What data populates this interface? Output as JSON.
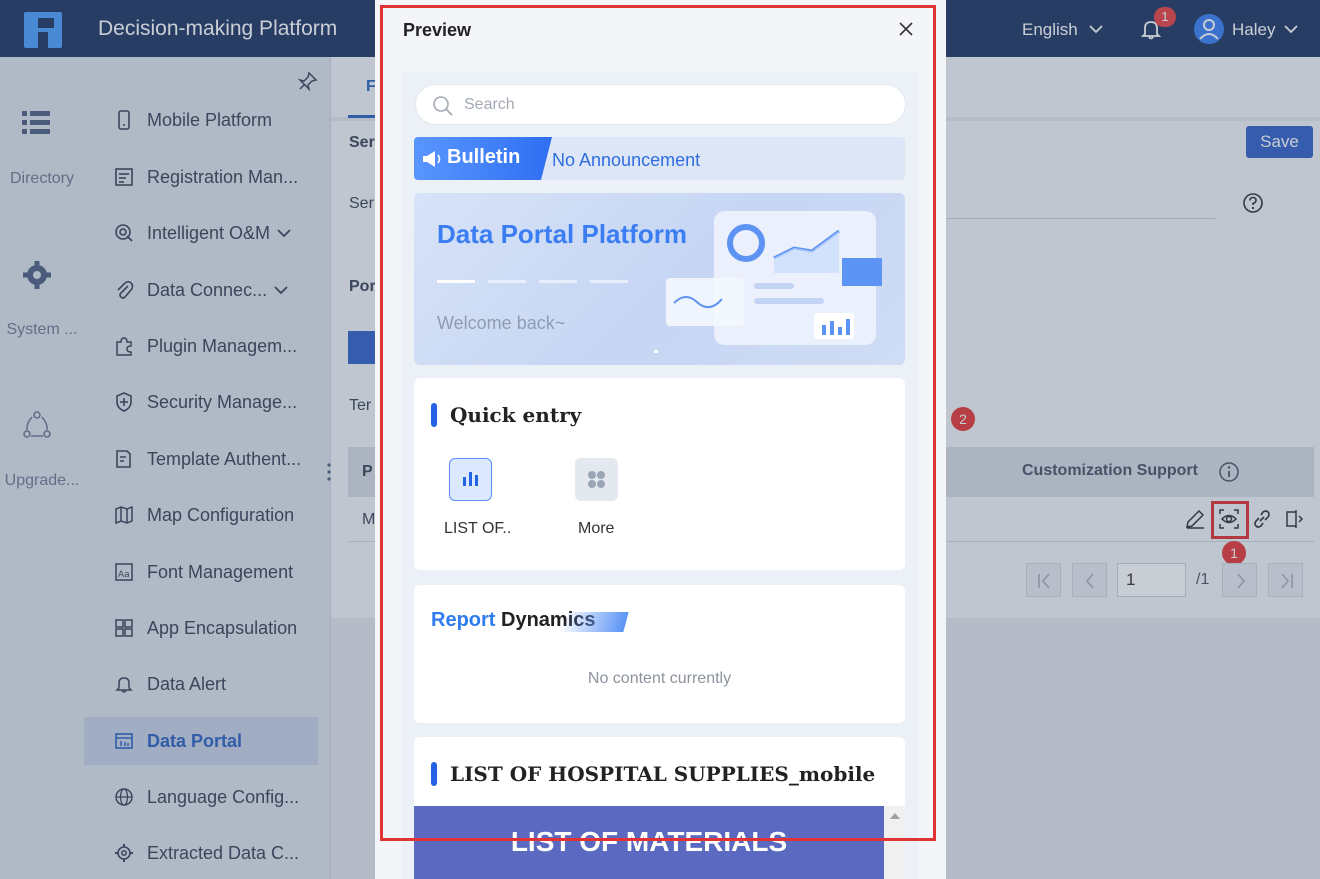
{
  "header": {
    "app_title": "Decision-making Platform",
    "language": "English",
    "notification_count": "1",
    "user_name": "Haley"
  },
  "rail": {
    "items": [
      {
        "label": "Directory",
        "icon": "list-icon"
      },
      {
        "label": "System ...",
        "icon": "gear-icon"
      },
      {
        "label": "Upgrade...",
        "icon": "upgrade-icon"
      }
    ]
  },
  "sidebar": {
    "items": [
      {
        "label": "Mobile Platform",
        "icon": "mobile-icon"
      },
      {
        "label": "Registration Man...",
        "icon": "registration-icon"
      },
      {
        "label": "Intelligent O&M",
        "icon": "om-icon"
      },
      {
        "label": "Data Connec...",
        "icon": "paperclip-icon"
      },
      {
        "label": "Plugin Managem...",
        "icon": "puzzle-icon"
      },
      {
        "label": "Security Manage...",
        "icon": "shield-icon"
      },
      {
        "label": "Template Authent...",
        "icon": "template-auth-icon"
      },
      {
        "label": "Map Configuration",
        "icon": "map-icon"
      },
      {
        "label": "Font Management",
        "icon": "font-icon"
      },
      {
        "label": "App Encapsulation",
        "icon": "app-grid-icon"
      },
      {
        "label": "Data Alert",
        "icon": "bell-icon"
      },
      {
        "label": "Data Portal",
        "icon": "portal-icon"
      },
      {
        "label": "Language Config...",
        "icon": "globe-icon"
      },
      {
        "label": "Extracted Data C...",
        "icon": "gear-icon"
      }
    ]
  },
  "background": {
    "tab_fragment": "F",
    "section_fragment_1": "Ser",
    "section_fragment_2": "Ser",
    "section_fragment_3": "Por",
    "terminal_fragment": "Ter",
    "table_head_fragment": "P",
    "row_fragment": "M",
    "save_label": "Save",
    "customization_label": "Customization Support",
    "page_input": "1",
    "page_total": "/1",
    "marker_1": "1",
    "marker_2": "2"
  },
  "modal": {
    "title": "Preview",
    "search_placeholder": "Search",
    "bulletin_label": "Bulletin",
    "bulletin_text": "No Announcement",
    "banner_title": "Data Portal Platform",
    "banner_subtitle": "Welcome back~",
    "quick_entry": {
      "title": "Quick entry",
      "items": [
        {
          "label": "LIST OF..",
          "icon": "bar-chart-icon"
        },
        {
          "label": "More",
          "icon": "more-grid-icon"
        }
      ]
    },
    "report": {
      "title_part_1": "Report",
      "title_part_2": "Dynamics",
      "empty_text": "No content currently"
    },
    "list_section": {
      "title": "LIST OF HOSPITAL SUPPLIES_mobile",
      "image_text": "LIST OF MATERIALS"
    }
  },
  "colors": {
    "topbar": "#1f3864",
    "accent": "#2364e6",
    "highlight": "#e03333"
  }
}
